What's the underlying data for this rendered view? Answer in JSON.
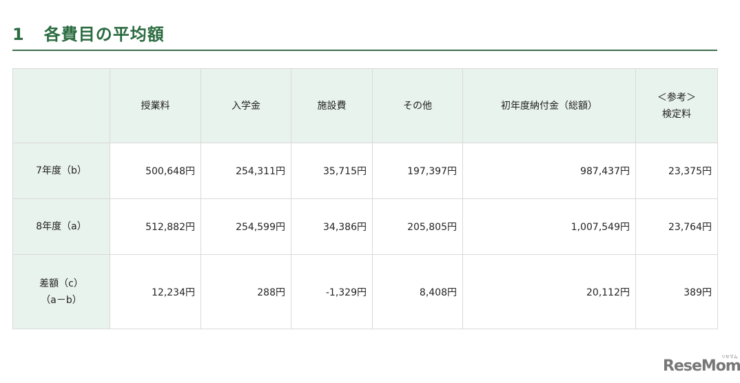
{
  "title": {
    "number": "1",
    "text": "各費目の平均額"
  },
  "table": {
    "headers": [
      "",
      "授業料",
      "入学金",
      "施設費",
      "その他",
      "初年度納付金（総額）",
      "＜参考＞",
      "検定料"
    ],
    "rows": [
      {
        "label": "7年度（b）",
        "values": [
          "500,648円",
          "254,311円",
          "35,715円",
          "197,397円",
          "987,437円",
          "23,375円"
        ]
      },
      {
        "label": "8年度（a）",
        "values": [
          "512,882円",
          "254,599円",
          "34,386円",
          "205,805円",
          "1,007,549円",
          "23,764円"
        ]
      },
      {
        "label": "差額（c）",
        "label2": "（a－b）",
        "values": [
          "12,234円",
          "288円",
          "-1,329円",
          "8,408円",
          "20,112円",
          "389円"
        ]
      }
    ]
  },
  "logo": {
    "text": "ReseMom",
    "sub": "リセマム"
  }
}
